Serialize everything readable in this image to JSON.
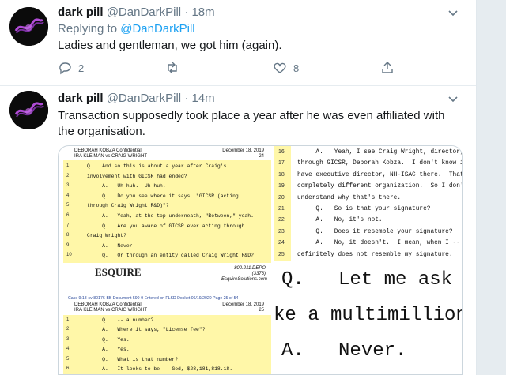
{
  "tweets": [
    {
      "name": "dark pill",
      "handle": "@DanDarkPill",
      "time": "18m",
      "replying_label": "Replying to",
      "replying_handle": "@DanDarkPill",
      "text": "Ladies and gentleman, we got him (again).",
      "reply_count": "2",
      "retweet_count": "",
      "like_count": "8"
    },
    {
      "name": "dark pill",
      "handle": "@DanDarkPill",
      "time": "14m",
      "text": "Transaction supposedly took place a year after he was even affiliated with the organisation."
    }
  ],
  "separator": "·",
  "icons": {
    "reply": "reply-icon",
    "retweet": "retweet-icon",
    "like": "like-icon",
    "share": "share-icon",
    "caret": "chevron-down-icon"
  },
  "colors": {
    "link": "#1da1f2",
    "muted": "#657786",
    "text": "#14171a",
    "highlight": "#fff7a8"
  },
  "doc_top": {
    "header_left_1": "DEBORAH KOBZA Confidential",
    "header_left_2": "IRA KLEIMAN vs CRAIG WRIGHT",
    "header_right_1": "December 18, 2019",
    "header_right_2": "24",
    "lines": [
      {
        "n": "1",
        "t": "Q.   And so this is about a year after Craig's"
      },
      {
        "n": "2",
        "t": "involvement with GICSR had ended?"
      },
      {
        "n": "3",
        "t": "     A.   Uh-huh.  Uh-huh."
      },
      {
        "n": "4",
        "t": "     Q.   Do you see where it says, \"GICSR (acting"
      },
      {
        "n": "5",
        "t": "through Craig Wright R&D)\"?"
      },
      {
        "n": "6",
        "t": "     A.   Yeah, at the top underneath, \"Between,\" yeah."
      },
      {
        "n": "7",
        "t": "     Q.   Are you aware of GICSR ever acting through"
      },
      {
        "n": "8",
        "t": "Craig Wright?"
      },
      {
        "n": "9",
        "t": "     A.   Never."
      },
      {
        "n": "10",
        "t": "     Q.   Or through an entity called Craig Wright R&D?"
      }
    ],
    "logo": "ESQUIRE",
    "phone": "800.211.DEPO (3376)",
    "site": "EsquireSolutions.com"
  },
  "doc_right": {
    "lines": [
      {
        "n": "16",
        "t": "     A.   Yeah, I see Craig Wright, director, and"
      },
      {
        "n": "17",
        "t": "through GICSR, Deborah Kobza.  I don't know if it wo"
      },
      {
        "n": "18",
        "t": "have executive director, NH-ISAC there.  That's a"
      },
      {
        "n": "19",
        "t": "completely different organization.  So I don't"
      },
      {
        "n": "20",
        "t": "understand why that's there."
      },
      {
        "n": "21",
        "t": "     Q.   So is that your signature?"
      },
      {
        "n": "22",
        "t": "     A.   No, it's not."
      },
      {
        "n": "23",
        "t": "     Q.   Does it resemble your signature?"
      },
      {
        "n": "24",
        "t": "     A.   No, it doesn't.  I mean, when I -- no.  This"
      },
      {
        "n": "25",
        "t": "definitely does not resemble my signature."
      }
    ],
    "zoom_1": "Q.   Let me ask",
    "zoom_2": "ke a multimillion",
    "zoom_3": "A.   Never."
  },
  "doc_bottom": {
    "case_line": "Case 9:18-cv-80176-BB   Document 590-9   Entered on FLSD Docket 06/19/2020   Page 25 of 54",
    "header_left_1": "DEBORAH KOBZA Confidential",
    "header_left_2": "IRA KLEIMAN vs CRAIG WRIGHT",
    "header_right_1": "December 18, 2019",
    "header_right_2": "25",
    "lines": [
      {
        "n": "1",
        "t": "     Q.   -- a number?"
      },
      {
        "n": "2",
        "t": "     A.   Where it says, \"License fee\"?"
      },
      {
        "n": "3",
        "t": "     Q.   Yes."
      },
      {
        "n": "4",
        "t": "     A.   Yes."
      },
      {
        "n": "5",
        "t": "     Q.   What is that number?"
      },
      {
        "n": "6",
        "t": "     A.   It looks to be -- God, $28,181,818.18."
      }
    ]
  }
}
